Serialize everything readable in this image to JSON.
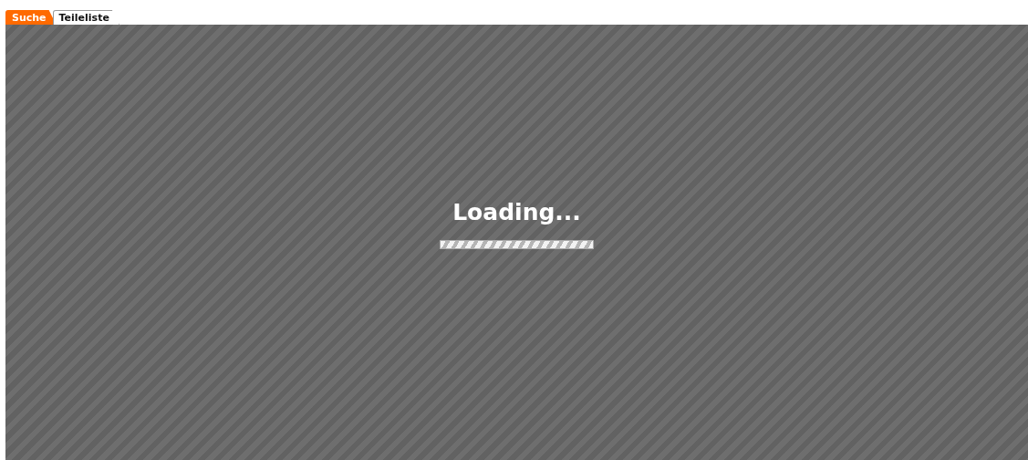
{
  "tabs": [
    {
      "label": "Suche",
      "selected": true
    },
    {
      "label": "Teileliste",
      "selected": false
    }
  ],
  "overlay": {
    "message": "Loading...",
    "progress": {
      "level": 1
    }
  }
}
